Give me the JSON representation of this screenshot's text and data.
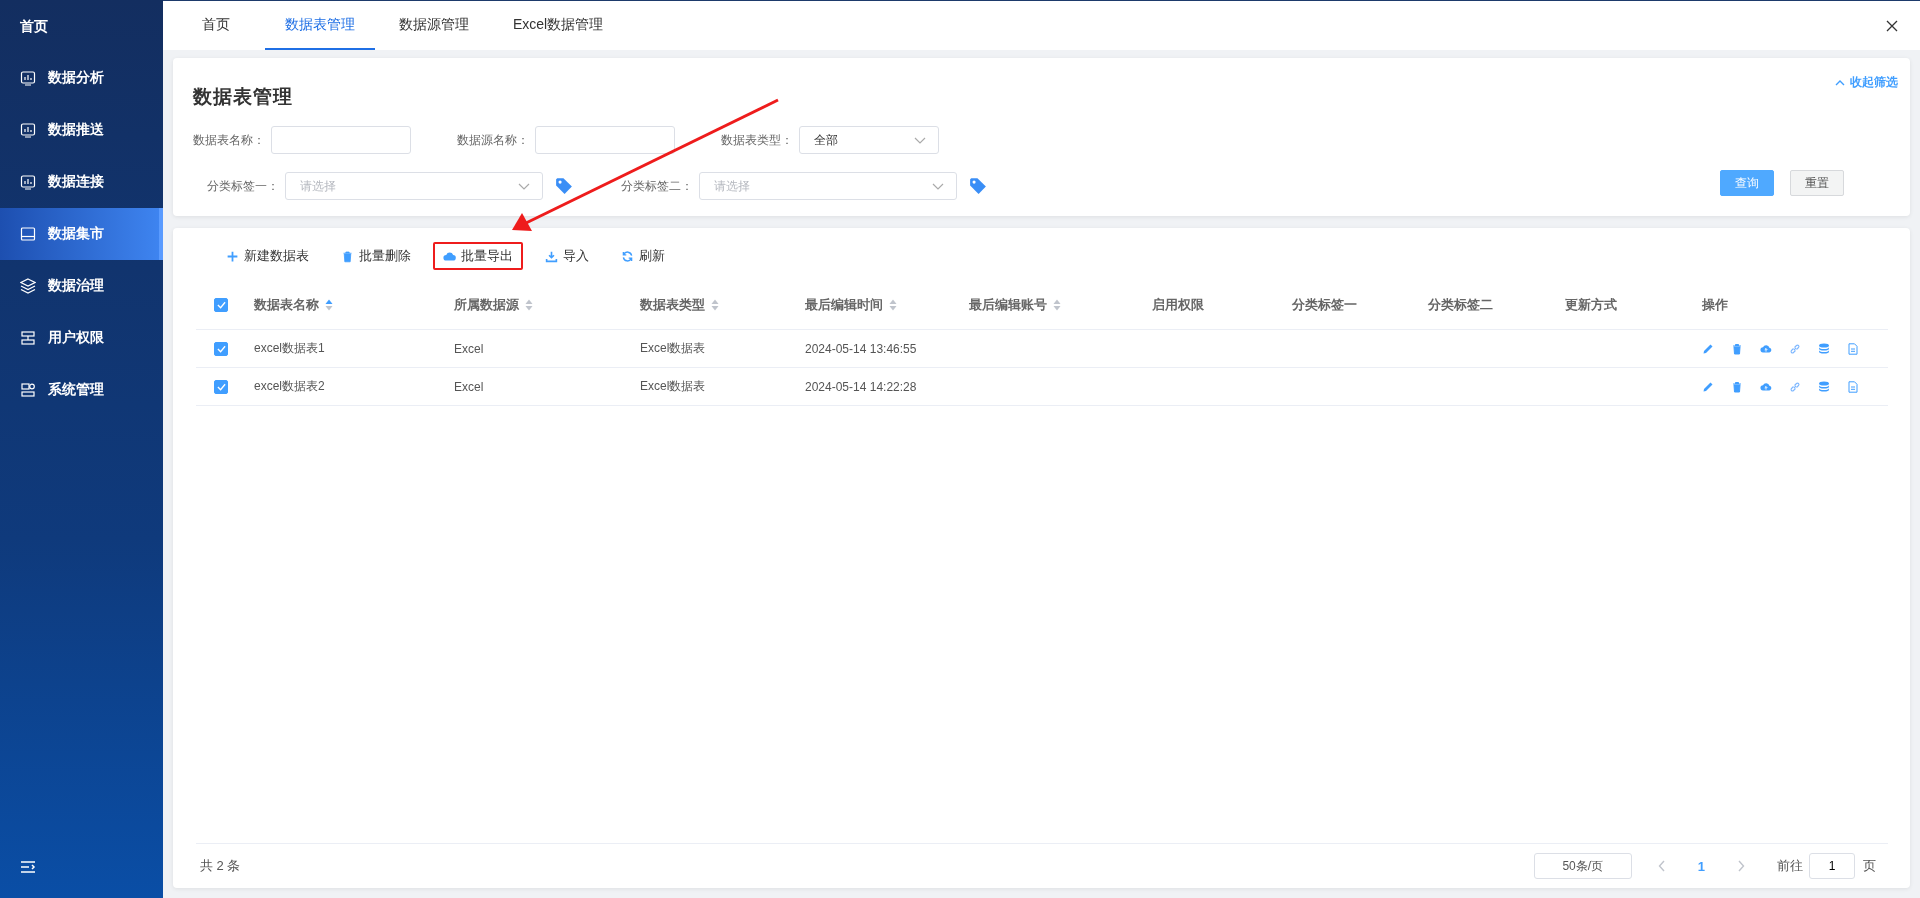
{
  "sidebar": {
    "home": "首页",
    "items": [
      {
        "label": "数据分析",
        "kind": "analysis",
        "selected": false
      },
      {
        "label": "数据推送",
        "kind": "push",
        "selected": false
      },
      {
        "label": "数据连接",
        "kind": "connect",
        "selected": false
      },
      {
        "label": "数据集市",
        "kind": "mart",
        "selected": true
      },
      {
        "label": "数据治理",
        "kind": "govern",
        "selected": false
      },
      {
        "label": "用户权限",
        "kind": "users",
        "selected": false
      },
      {
        "label": "系统管理",
        "kind": "system",
        "selected": false
      }
    ]
  },
  "tabs": [
    {
      "label": "首页",
      "selected": false
    },
    {
      "label": "数据表管理",
      "selected": true
    },
    {
      "label": "数据源管理",
      "selected": false
    },
    {
      "label": "Excel数据管理",
      "selected": false
    }
  ],
  "filter_panel": {
    "title": "数据表管理",
    "collapse_link": "收起筛选",
    "rows": [
      [
        {
          "kind": "input",
          "label": "数据表名称："
        },
        {
          "kind": "input",
          "label": "数据源名称："
        },
        {
          "kind": "select",
          "label": "数据表类型：",
          "value": "全部"
        }
      ],
      [
        {
          "kind": "tag_select",
          "label": "分类标签一：",
          "placeholder": "请选择"
        },
        {
          "kind": "tag_select",
          "label": "分类标签二：",
          "placeholder": "请选择"
        }
      ]
    ],
    "buttons": [
      {
        "label": "查询",
        "kind": "primary"
      },
      {
        "label": "重置",
        "kind": "default"
      }
    ]
  },
  "toolbar": [
    {
      "label": "新建数据表",
      "kind": "add",
      "highlighted": false
    },
    {
      "label": "批量删除",
      "kind": "delete",
      "highlighted": false
    },
    {
      "label": "批量导出",
      "kind": "export",
      "highlighted": true
    },
    {
      "label": "导入",
      "kind": "import",
      "highlighted": false
    },
    {
      "label": "刷新",
      "kind": "refresh",
      "highlighted": false
    }
  ],
  "table": {
    "header_checked": true,
    "columns": [
      {
        "label": "数据表名称",
        "kind": "text",
        "sorted": true
      },
      {
        "label": "所属数据源",
        "kind": "text",
        "sorted": false
      },
      {
        "label": "数据表类型",
        "kind": "text",
        "sorted": false
      },
      {
        "label": "最后编辑时间",
        "kind": "text",
        "sorted": false
      },
      {
        "label": "最后编辑账号",
        "kind": "text",
        "sorted": false
      },
      {
        "label": "启用权限",
        "kind": "text"
      },
      {
        "label": "分类标签一",
        "kind": "text"
      },
      {
        "label": "分类标签二",
        "kind": "text"
      },
      {
        "label": "更新方式",
        "kind": "text"
      },
      {
        "label": "操作",
        "kind": "actions"
      }
    ],
    "rows": [
      {
        "checked": true,
        "cells": [
          "excel数据表1",
          "Excel",
          "Excel数据表",
          "2024-05-14 13:46:55"
        ]
      },
      {
        "checked": true,
        "cells": [
          "excel数据表2",
          "Excel",
          "Excel数据表",
          "2024-05-14 14:22:28"
        ]
      }
    ]
  },
  "pagination": {
    "total": "共 2 条",
    "page_size": "50条/页",
    "pages": [
      {
        "label": "1",
        "selected": true
      }
    ],
    "goto_label": "前往",
    "goto_value": "1",
    "goto_suffix": "页"
  }
}
